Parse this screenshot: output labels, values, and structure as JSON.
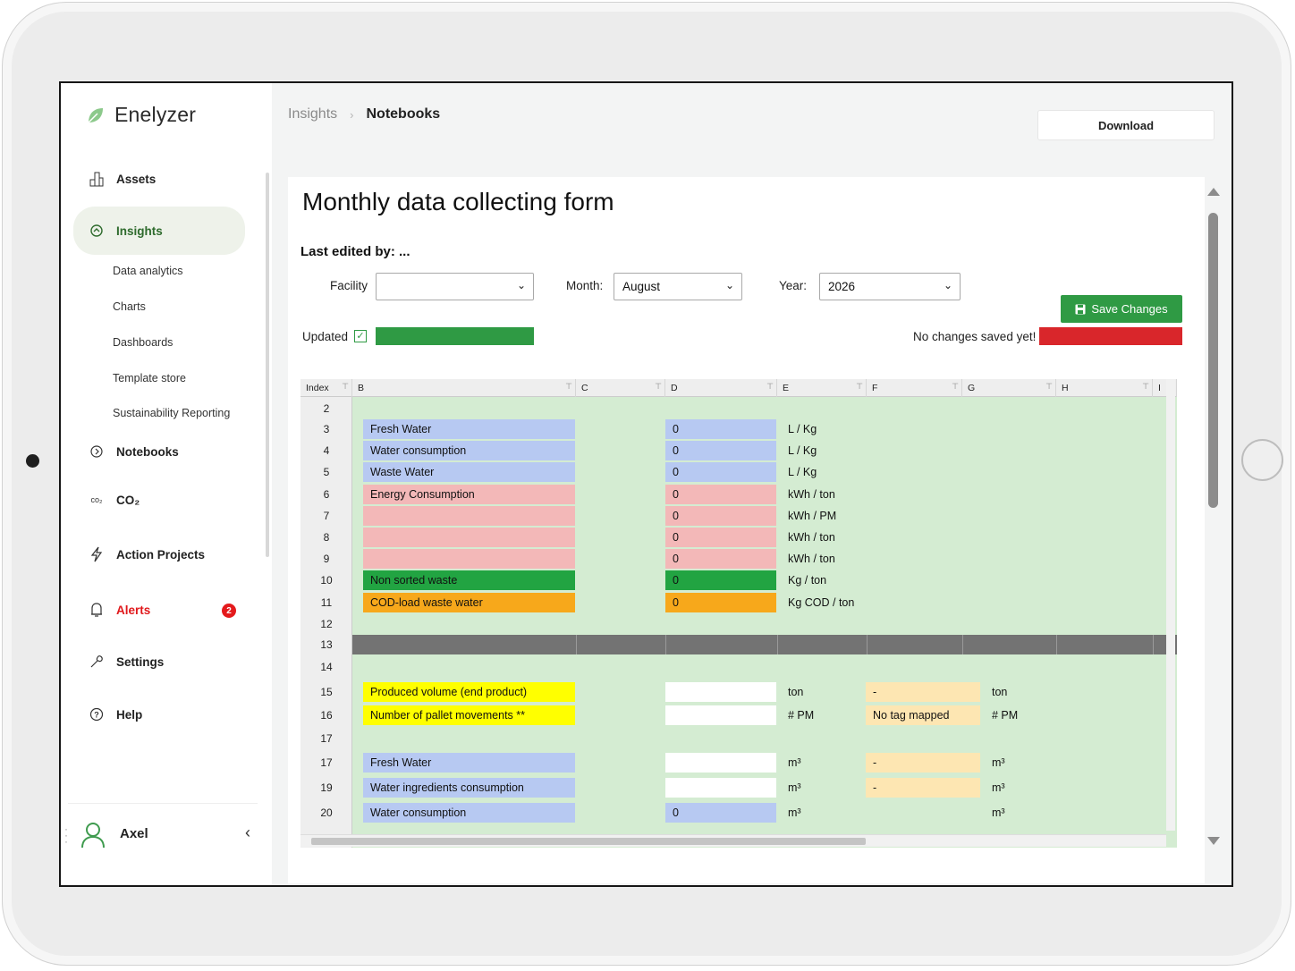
{
  "brand": {
    "name": "Enelyzer"
  },
  "sidebar": {
    "items": [
      {
        "label": "Assets"
      },
      {
        "label": "Insights"
      },
      {
        "label": "Notebooks"
      },
      {
        "label": "CO₂",
        "icon_text": "co₂"
      },
      {
        "label": "Action Projects"
      },
      {
        "label": "Alerts",
        "badge": "2"
      },
      {
        "label": "Settings"
      },
      {
        "label": "Help"
      }
    ],
    "insights_sub": [
      "Data analytics",
      "Charts",
      "Dashboards",
      "Template store",
      "Sustainability Reporting"
    ],
    "user": {
      "name": "Axel"
    }
  },
  "header": {
    "breadcrumb": [
      "Insights",
      "Notebooks"
    ],
    "download_label": "Download"
  },
  "form": {
    "title": "Monthly data collecting form",
    "last_edited": "Last edited by: ...",
    "facility_label": "Facility",
    "facility_value": "",
    "month_label": "Month:",
    "month_value": "August",
    "year_label": "Year:",
    "year_value": "2026",
    "save_label": "Save Changes",
    "updated_label": "Updated",
    "no_changes_label": "No changes saved yet!"
  },
  "colors": {
    "accent_green": "#2f9a44",
    "status_red": "#d9262b",
    "blue_cell": "#b7c9f2",
    "pink_cell": "#f3b8b8",
    "green_cell": "#22a442",
    "orange_cell": "#f7a81b",
    "yellow_cell": "#ffff00",
    "tan_cell": "#fde6b2",
    "sheet_bg": "#d4ecd2"
  },
  "sheet": {
    "columns": [
      "Index",
      "B",
      "C",
      "D",
      "E",
      "F",
      "G",
      "H",
      "I"
    ],
    "rows": [
      {
        "index": "2",
        "b": "",
        "d": "",
        "e": "",
        "f": "",
        "g": ""
      },
      {
        "index": "3",
        "b": "Fresh Water",
        "d": "0",
        "e": "L / Kg",
        "f": "",
        "g": "",
        "color": "blue"
      },
      {
        "index": "4",
        "b": "Water consumption",
        "d": "0",
        "e": "L / Kg",
        "f": "",
        "g": "",
        "color": "blue"
      },
      {
        "index": "5",
        "b": "Waste Water",
        "d": "0",
        "e": "L / Kg",
        "f": "",
        "g": "",
        "color": "blue"
      },
      {
        "index": "6",
        "b": "Energy Consumption",
        "d": "0",
        "e": "kWh / ton",
        "f": "",
        "g": "",
        "color": "pink"
      },
      {
        "index": "7",
        "b": "",
        "d": "0",
        "e": "kWh / PM",
        "f": "",
        "g": "",
        "color": "pink"
      },
      {
        "index": "8",
        "b": "",
        "d": "0",
        "e": "kWh / ton",
        "f": "",
        "g": "",
        "color": "pink"
      },
      {
        "index": "9",
        "b": "",
        "d": "0",
        "e": "kWh / ton",
        "f": "",
        "g": "",
        "color": "pink"
      },
      {
        "index": "10",
        "b": "Non sorted waste",
        "d": "0",
        "e": "Kg / ton",
        "f": "",
        "g": "",
        "color": "green"
      },
      {
        "index": "11",
        "b": "COD-load waste water",
        "d": "0",
        "e": "Kg COD / ton",
        "f": "",
        "g": "",
        "color": "orange"
      },
      {
        "index": "12",
        "b": "",
        "d": "",
        "e": "",
        "f": "",
        "g": ""
      },
      {
        "index": "13",
        "separator": true
      },
      {
        "index": "14",
        "b": "",
        "d": "",
        "e": "",
        "f": "",
        "g": ""
      },
      {
        "index": "15",
        "b": "Produced volume (end product)",
        "d": "",
        "e": "ton",
        "f": "-",
        "g": "ton",
        "color": "yellow"
      },
      {
        "index": "16",
        "b": "Number of pallet movements **",
        "d": "",
        "e": "# PM",
        "f": "No tag mapped",
        "g": "# PM",
        "color": "yellow"
      },
      {
        "index": "17",
        "b": "",
        "d": "",
        "e": "",
        "f": "",
        "g": ""
      },
      {
        "index": "17",
        "b": "Fresh Water",
        "d": "",
        "e": "m³",
        "f": "-",
        "g": "m³",
        "color": "blue"
      },
      {
        "index": "19",
        "b": "Water ingredients consumption",
        "d": "",
        "e": "m³",
        "f": "-",
        "g": "m³",
        "color": "blue"
      },
      {
        "index": "20",
        "b": "Water consumption",
        "d": "0",
        "e": "m³",
        "f": "",
        "g": "m³",
        "color": "blue"
      }
    ]
  }
}
